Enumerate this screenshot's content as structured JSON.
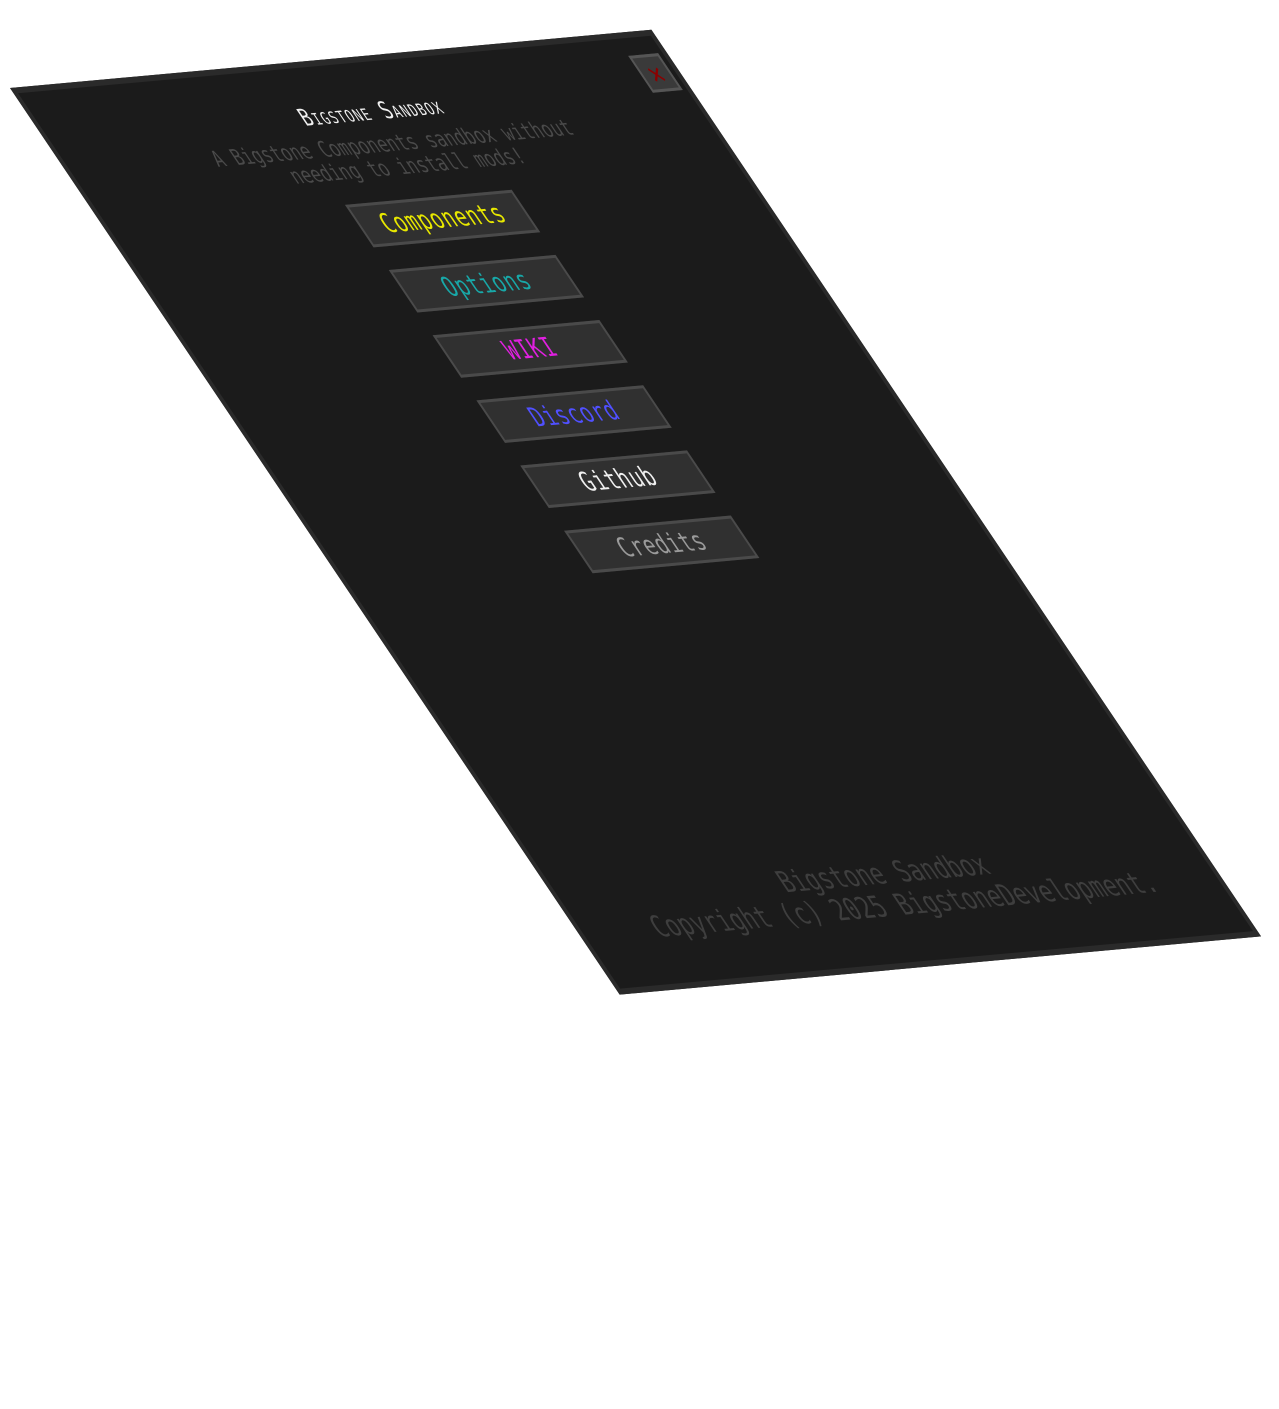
{
  "window": {
    "title": "Bigstone Sandbox",
    "subtitle": "A Bigstone Components sandbox without needing to install mods!",
    "close_label": "✕"
  },
  "menu": {
    "items": [
      {
        "label": "Components",
        "color": "#e8e800"
      },
      {
        "label": "Options",
        "color": "#18a8a8"
      },
      {
        "label": "WIKI",
        "color": "#e020e0"
      },
      {
        "label": "Discord",
        "color": "#5050ff"
      },
      {
        "label": "Github",
        "color": "#f0f0f0"
      },
      {
        "label": "Credits",
        "color": "#9a9a9a"
      }
    ]
  },
  "footer": {
    "line1": "Bigstone Sandbox",
    "line2": "Copyright (c) 2025 BigstoneDevelopment."
  },
  "colors": {
    "panel_background": "#1b1b1b",
    "panel_border": "#2a2a2a",
    "button_background": "#303030",
    "button_border": "#4a4a4a",
    "close_icon": "#8b0000",
    "page_background": "#ffffff"
  }
}
